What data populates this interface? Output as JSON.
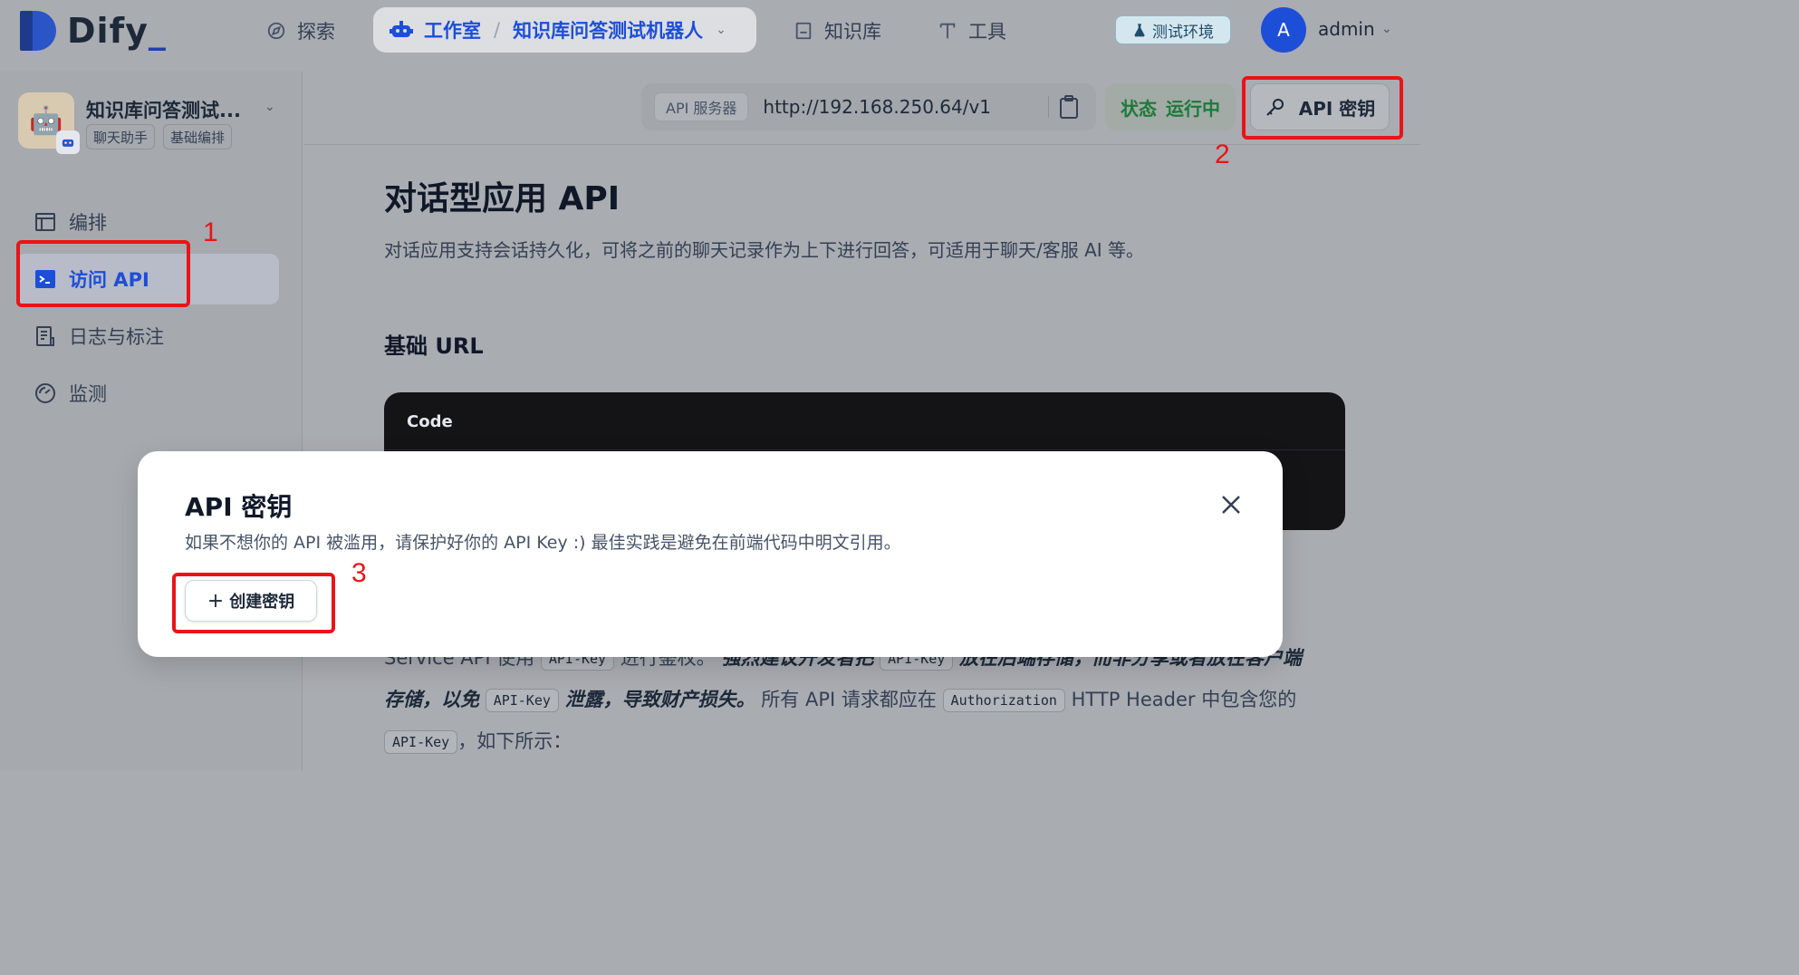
{
  "brand": {
    "logo_text": "Dify",
    "logo_accent": "_"
  },
  "topnav": {
    "explore": "探索",
    "studio": "工作室",
    "current_app": "知识库问答测试机器人",
    "knowledge": "知识库",
    "tools": "工具",
    "env_badge": "测试环境",
    "avatar_initial": "A",
    "user": "admin"
  },
  "sidebar": {
    "app_name": "知识库问答测试...",
    "tags": [
      "聊天助手",
      "基础编排"
    ],
    "items": [
      {
        "label": "编排",
        "icon": "layout-icon",
        "active": false
      },
      {
        "label": "访问 API",
        "icon": "terminal-icon",
        "active": true
      },
      {
        "label": "日志与标注",
        "icon": "log-icon",
        "active": false
      },
      {
        "label": "监测",
        "icon": "gauge-icon",
        "active": false
      }
    ]
  },
  "header": {
    "server_label": "API 服务器",
    "server_url": "http://192.168.250.64/v1",
    "status_label": "状态",
    "status_value": "运行中",
    "api_key_button": "API 密钥"
  },
  "doc": {
    "title": "对话型应用 API",
    "description": "对话应用支持会话持久化，可将之前的聊天记录作为上下进行回答，可适用于聊天/客服 AI 等。",
    "base_url_heading": "基础 URL",
    "code_label": "Code",
    "para1_prefix": "Service API 使用",
    "para1_chip1": "API-Key",
    "para1_mid": "进行鉴权。",
    "para1_bold": "强烈建议开发者把",
    "para1_chip2": "API-Key",
    "para1_bold2": "放在后端存储，而非分享或者放在客户端",
    "para2_bold": "存储，以免",
    "para2_chip": "API-Key",
    "para2_bold2": "泄露，导致财产损失。",
    "para2_text": "所有 API 请求都应在",
    "para2_chip2": "Authorization",
    "para2_text2": "HTTP Header 中包含您的",
    "para3_chip": "API-Key",
    "para3_text": "，如下所示："
  },
  "modal": {
    "title": "API 密钥",
    "description": "如果不想你的 API 被滥用，请保护好你的 API Key :) 最佳实践是避免在前端代码中明文引用。",
    "create_button": "创建密钥"
  },
  "annotations": [
    "1",
    "2",
    "3"
  ],
  "colors": {
    "accent": "#1d4ed8",
    "annotation": "#e8141a",
    "status_green": "#1d7a3a"
  }
}
